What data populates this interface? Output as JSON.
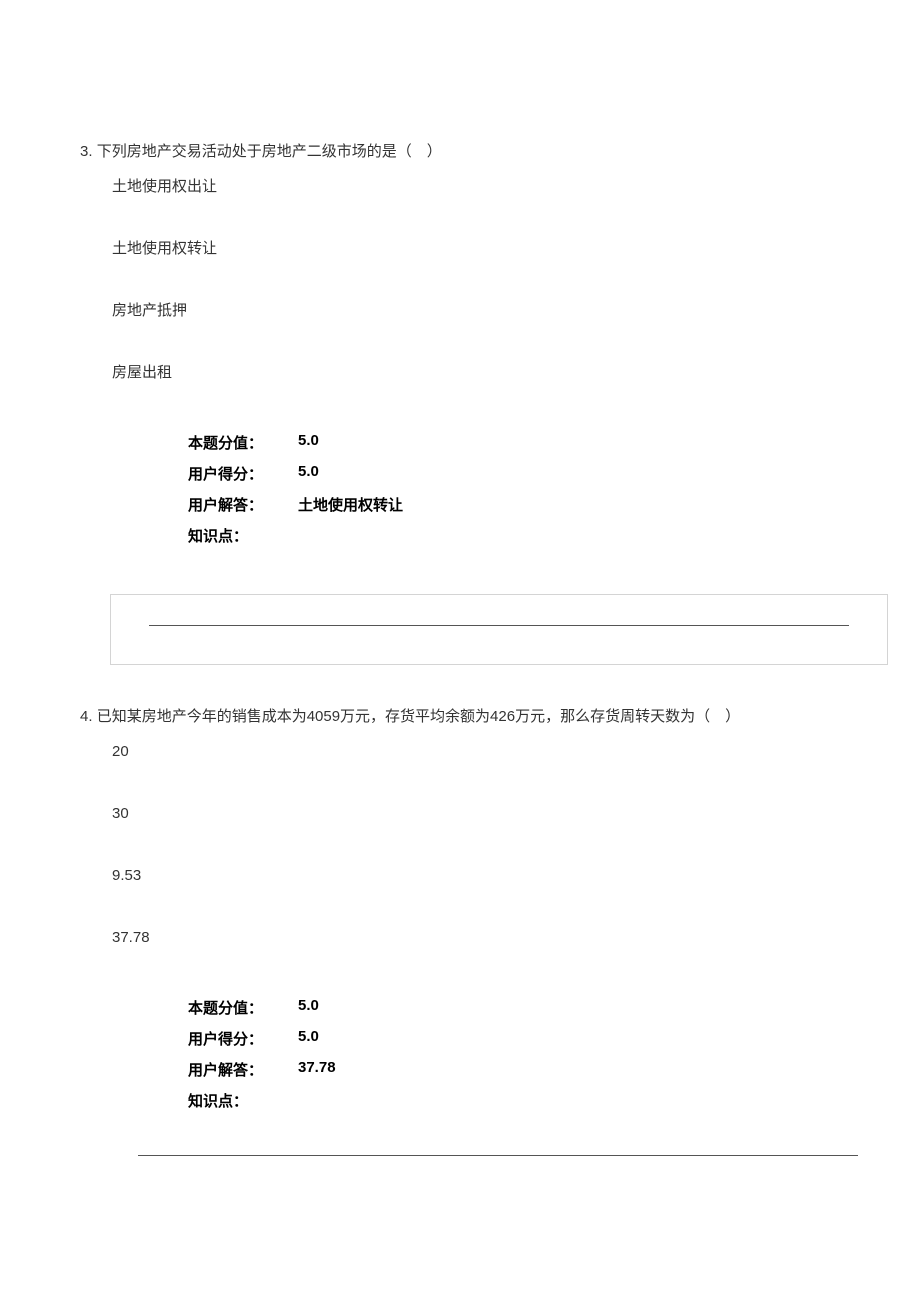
{
  "questions": [
    {
      "number": "3.",
      "text": "下列房地产交易活动处于房地产二级市场的是（　）",
      "options": [
        "土地使用权出让",
        "土地使用权转让",
        "房地产抵押",
        "房屋出租"
      ],
      "info": {
        "score_label": "本题分值：",
        "score_value": "5.0",
        "user_score_label": "用户得分：",
        "user_score_value": "5.0",
        "user_answer_label": "用户解答：",
        "user_answer_value": "土地使用权转让",
        "kp_label": "知识点："
      }
    },
    {
      "number": "4.",
      "text": "已知某房地产今年的销售成本为4059万元，存货平均余额为426万元，那么存货周转天数为（　）",
      "options": [
        "20",
        "30",
        "9.53",
        "37.78"
      ],
      "info": {
        "score_label": "本题分值：",
        "score_value": "5.0",
        "user_score_label": "用户得分：",
        "user_score_value": "5.0",
        "user_answer_label": "用户解答：",
        "user_answer_value": "37.78",
        "kp_label": "知识点："
      }
    }
  ]
}
